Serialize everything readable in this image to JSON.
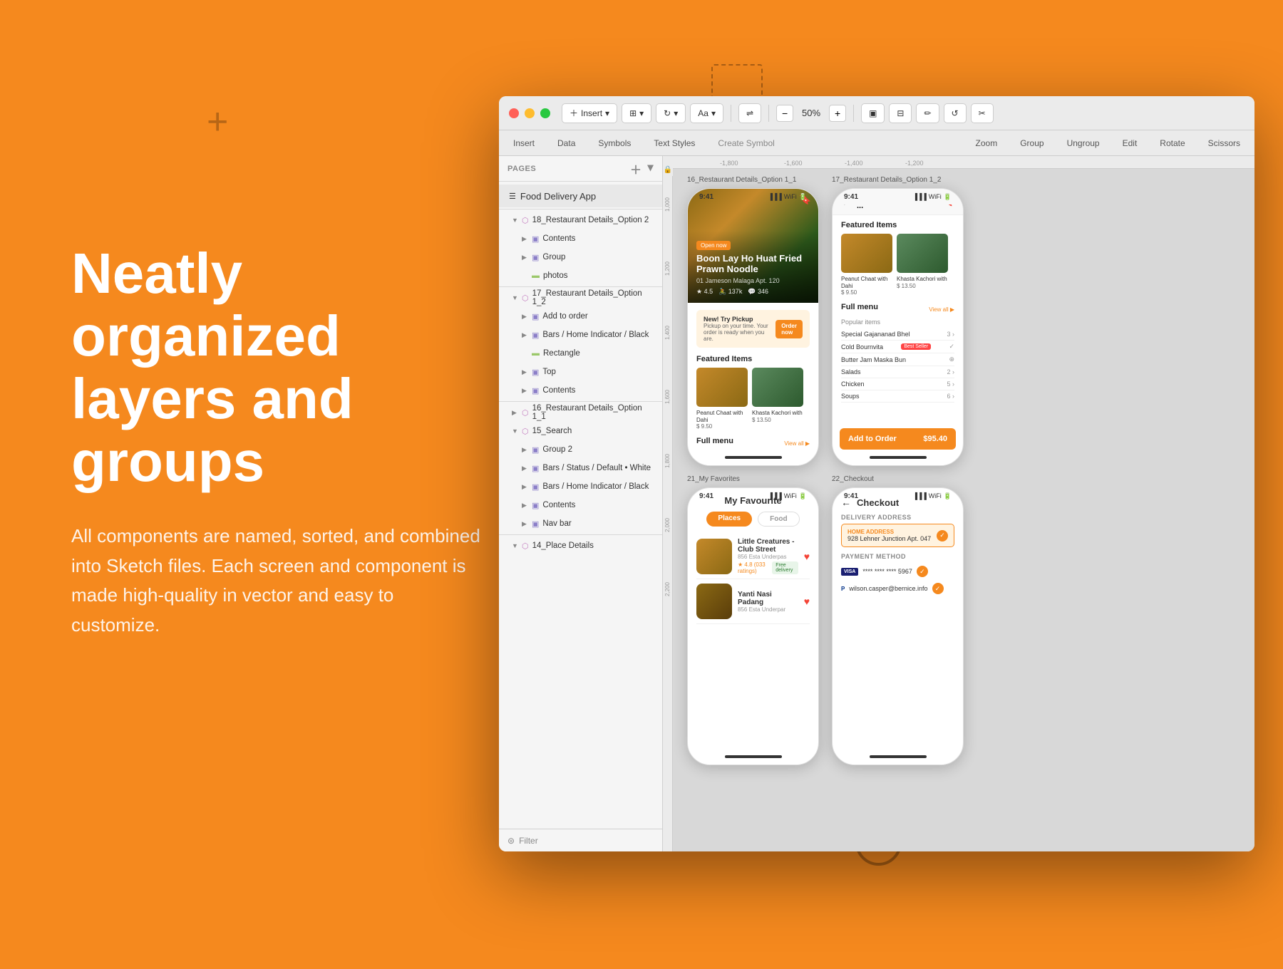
{
  "background": "#F5891E",
  "hero": {
    "title": "Neatly organized layers and groups",
    "subtitle": "All components are named, sorted, and combined into Sketch files. Each screen and component is made high-quality in vector and easy to customize."
  },
  "sketch": {
    "app_name": "Food Delivery",
    "toolbar": {
      "insert": "Insert",
      "data": "Data",
      "symbols": "Symbols",
      "text_styles": "Text Styles",
      "create_symbol": "Create Symbol",
      "zoom": "Zoom",
      "group": "Group",
      "ungroup": "Ungroup",
      "edit": "Edit",
      "rotate": "Rotate",
      "scissors": "Scissors",
      "zoom_value": "50%"
    },
    "sidebar": {
      "pages_label": "PAGES",
      "page_name": "Food Delivery App",
      "layers": [
        {
          "name": "18_Restaurant Details_Option 2",
          "level": 0,
          "type": "symbol",
          "expanded": true
        },
        {
          "name": "Contents",
          "level": 1,
          "type": "group"
        },
        {
          "name": "Group",
          "level": 1,
          "type": "group"
        },
        {
          "name": "photos",
          "level": 1,
          "type": "rect"
        },
        {
          "name": "17_Restaurant Details_Option 1_2",
          "level": 0,
          "type": "symbol",
          "expanded": true
        },
        {
          "name": "Add to order",
          "level": 1,
          "type": "group"
        },
        {
          "name": "Bars / Home Indicator / Black",
          "level": 1,
          "type": "group"
        },
        {
          "name": "Rectangle",
          "level": 1,
          "type": "rect"
        },
        {
          "name": "Top",
          "level": 1,
          "type": "group"
        },
        {
          "name": "Contents",
          "level": 1,
          "type": "group"
        },
        {
          "name": "16_Restaurant Details_Option 1_1",
          "level": 0,
          "type": "symbol"
        },
        {
          "name": "15_Search",
          "level": 0,
          "type": "symbol",
          "expanded": true
        },
        {
          "name": "Group 2",
          "level": 1,
          "type": "group"
        },
        {
          "name": "Bars / Status / Default • White",
          "level": 1,
          "type": "group"
        },
        {
          "name": "Bars / Home Indicator / Black",
          "level": 1,
          "type": "group"
        },
        {
          "name": "Contents",
          "level": 1,
          "type": "group"
        },
        {
          "name": "Nav bar",
          "level": 1,
          "type": "group"
        },
        {
          "name": "14_Place Details",
          "level": 0,
          "type": "symbol"
        }
      ],
      "filter": "Filter"
    },
    "canvas": {
      "ruler_marks": [
        "-1,800",
        "-1,600",
        "-1,400",
        "-1,200"
      ],
      "ruler_v_marks": [
        "1,000",
        "1,200",
        "1,400",
        "1,600",
        "1,800",
        "2,000",
        "2,200"
      ],
      "frames": [
        {
          "label": "16_Restaurant Details_Option 1_1",
          "type": "restaurant_detail_1"
        },
        {
          "label": "17_Restaurant Details_Option 1_2",
          "type": "restaurant_detail_2"
        },
        {
          "label": "21_My Favorites",
          "type": "favorites"
        },
        {
          "label": "22_Checkout",
          "type": "checkout"
        }
      ]
    }
  }
}
